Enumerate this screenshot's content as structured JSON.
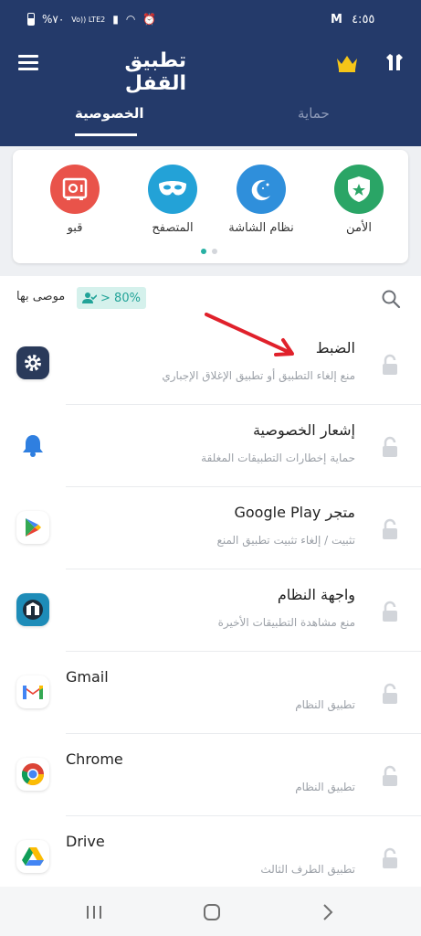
{
  "status": {
    "left_text": "%٧٠",
    "net_text": "Vo)) LTE2",
    "time": "٤:٥٥"
  },
  "app": {
    "title": "تطبيق القفل"
  },
  "tabs": [
    {
      "label": "حماية",
      "active": false
    },
    {
      "label": "الخصوصية",
      "active": true
    }
  ],
  "features": [
    {
      "label": "الأمن",
      "icon": "shield-star-icon",
      "color": "#2aa566"
    },
    {
      "label": "نظام الشاشة",
      "icon": "moon-stars-icon",
      "color": "#2f8fdb"
    },
    {
      "label": "المتصفح",
      "icon": "mask-icon",
      "color": "#23a2d7"
    },
    {
      "label": "قبو",
      "icon": "vault-icon",
      "color": "#e9534a"
    }
  ],
  "recommend": {
    "badge": "> 80%",
    "label": "موصى بها"
  },
  "apps": [
    {
      "title": "الضبط",
      "subtitle": "منع إلغاء التطبيق أو تطبيق الإغلاق الإجباري",
      "icon": "settings-gear-icon"
    },
    {
      "title": "إشعار الخصوصية",
      "subtitle": "حماية إخطارات التطبيقات المغلقة",
      "icon": "bell-icon"
    },
    {
      "title": "متجر Google Play",
      "subtitle": "تثبيت / إلغاء تثبيت تطبيق المنع",
      "icon": "play-store-icon"
    },
    {
      "title": "واجهة النظام",
      "subtitle": "منع مشاهدة التطبيقات الأخيرة",
      "icon": "system-ui-icon"
    },
    {
      "title": "Gmail",
      "subtitle": "تطبيق النظام",
      "icon": "gmail-icon"
    },
    {
      "title": "Chrome",
      "subtitle": "تطبيق النظام",
      "icon": "chrome-icon"
    },
    {
      "title": "Drive",
      "subtitle": "تطبيق الطرف الثالث",
      "icon": "drive-icon"
    }
  ],
  "colors": {
    "header": "#243a6a",
    "accent": "#27b0a3",
    "arrow": "#e0212b"
  }
}
